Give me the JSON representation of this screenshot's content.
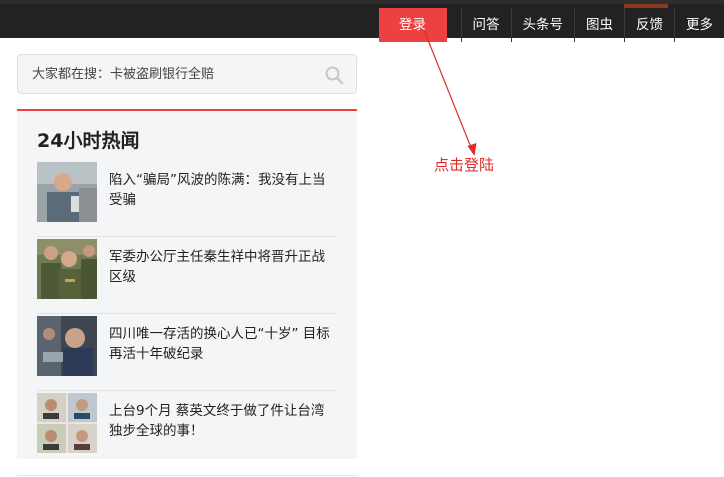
{
  "nav": {
    "login": "登录",
    "items": [
      "问答",
      "头条号",
      "图虫",
      "反馈",
      "更多"
    ]
  },
  "search": {
    "placeholder": "大家都在搜：卡被盗刷银行全赔"
  },
  "hot_news": {
    "title": "24小时热闻",
    "items": [
      {
        "title": "陷入“骗局”风波的陈满：我没有上当受骗"
      },
      {
        "title": "军委办公厅主任秦生祥中将晋升正战区级"
      },
      {
        "title": "四川唯一存活的换心人已“十岁” 目标再活十年破纪录"
      },
      {
        "title": "上台9个月 蔡英文终于做了件让台湾独步全球的事！"
      }
    ]
  },
  "annotation": {
    "text": "点击登陆"
  },
  "colors": {
    "topbar": "#222222",
    "accent": "#ed4040",
    "panel_bg": "#f4f5f6",
    "annotation": "#e02b2b"
  }
}
